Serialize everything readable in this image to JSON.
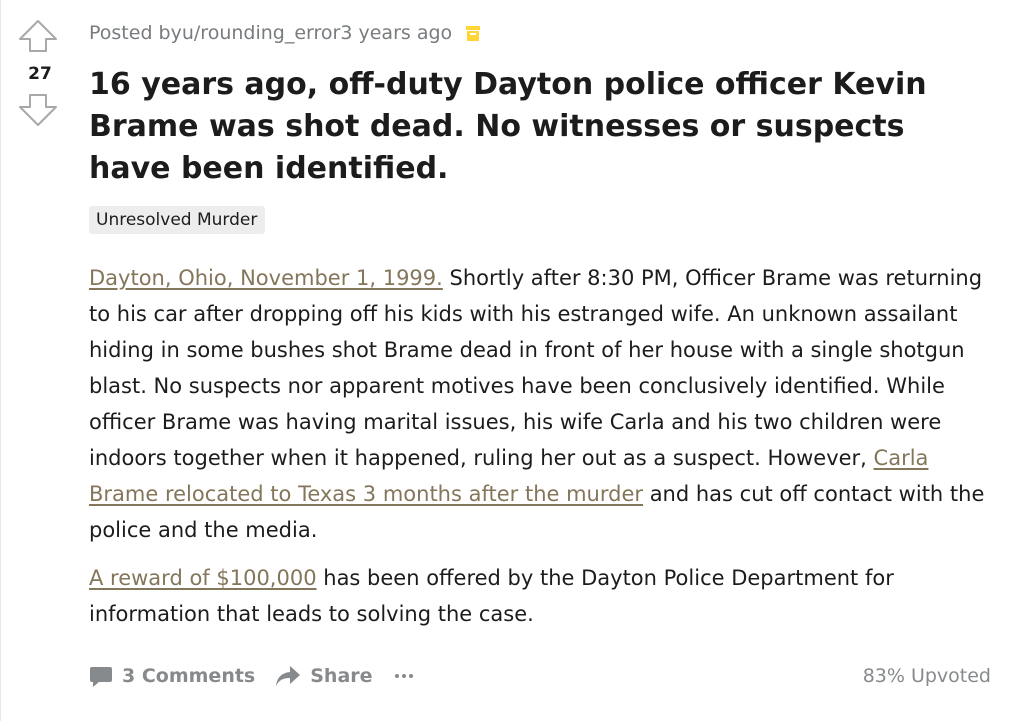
{
  "post": {
    "meta": {
      "prefix": "Posted by ",
      "author": "u/rounding_error",
      "time": " 3 years ago",
      "archived_icon": "archive-box-icon"
    },
    "score": "27",
    "title": "16 years ago, off-duty Dayton police officer Kevin Brame was shot dead. No witnesses or suspects have been identified.",
    "flair": "Unresolved Murder",
    "body": {
      "p1_link1": "Dayton, Ohio, November 1, 1999.",
      "p1_text1": " Shortly after 8:30 PM, Officer Brame was returning to his car after dropping off his kids with his estranged wife. An unknown assailant hiding in some bushes shot Brame dead in front of her house with a single shotgun blast. No suspects nor apparent motives have been conclusively identified. While officer Brame was having marital issues, his wife Carla and his two children were indoors together when it happened, ruling her out as a suspect. However, ",
      "p1_link2": "Carla Brame relocated to Texas 3 months after the murder",
      "p1_text2": " and has cut off contact with the police and the media.",
      "p2_link": "A reward of $100,000",
      "p2_text": " has been offered by the Dayton Police Department for information that leads to solving the case."
    },
    "footer": {
      "comments_label": "3 Comments",
      "share_label": "Share",
      "more_icon": "ellipsis-icon",
      "upvoted": "83% Upvoted"
    }
  },
  "colors": {
    "link": "#84765a",
    "meta": "#787c7e",
    "footer": "#878a8c",
    "flair_bg": "#ededed",
    "archive_icon": "#ffd635"
  }
}
